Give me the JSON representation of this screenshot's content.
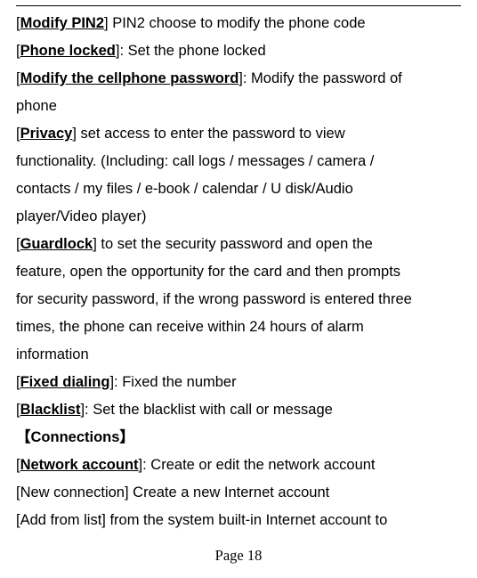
{
  "lines": {
    "l1_a": "Modify PIN2",
    "l1_b": "] PIN2 choose to modify the phone code",
    "l2_a": "Phone locked",
    "l2_b": "]: Set the phone locked",
    "l3_a": "Modify the cellphone password",
    "l3_b": "]: Modify the password of",
    "l4": "phone",
    "l5_a": "Privacy",
    "l5_b": "] set access to enter the password to view",
    "l6": "functionality. (Including: call logs / messages / camera /",
    "l7": "contacts / my files / e-book / calendar / U disk/Audio",
    "l8": "player/Video player)",
    "l9_a": "Guardlock",
    "l9_b": "] to set the security password and open the",
    "l10": "feature, open the opportunity for the card and then prompts",
    "l11": "for security password, if the wrong password is entered three",
    "l12": "times, the phone can receive within 24 hours of alarm",
    "l13": "information",
    "l14_a": "Fixed dialing",
    "l14_b": "]: Fixed the number",
    "l15_a": "Blacklist",
    "l15_b": "]: Set the blacklist with call or message",
    "l16_a": "【",
    "l16_b": "Connections",
    "l16_c": "】",
    "l17_a": "Network account",
    "l17_b": "]: Create or edit the network account",
    "l18": "[New connection] Create a new Internet account",
    "l19": "[Add from list] from the system built-in Internet account to"
  },
  "footer": "Page 18"
}
